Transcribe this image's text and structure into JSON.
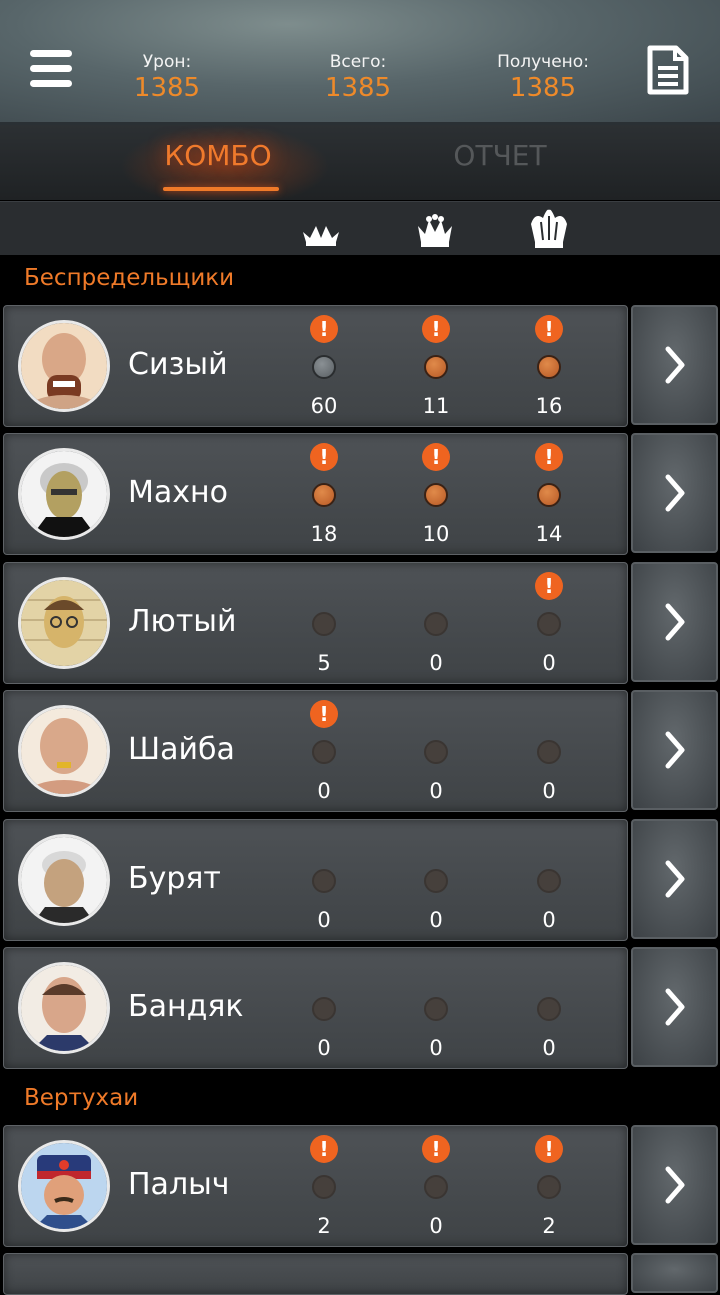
{
  "header": {
    "stats": [
      {
        "label": "Урон:",
        "value": "1385"
      },
      {
        "label": "Всего:",
        "value": "1385"
      },
      {
        "label": "Получено:",
        "value": "1385"
      }
    ]
  },
  "tabs": [
    {
      "label": "КОМБО",
      "active": true
    },
    {
      "label": "ОТЧЕТ",
      "active": false
    }
  ],
  "sections": [
    {
      "title": "Беспредельщики"
    },
    {
      "title": "Вертухаи"
    }
  ],
  "rows": [
    {
      "name": "Сизый",
      "alerts": [
        true,
        true,
        true
      ],
      "dots": [
        "grey",
        "orange",
        "orange"
      ],
      "counts": [
        "60",
        "11",
        "16"
      ]
    },
    {
      "name": "Махно",
      "alerts": [
        true,
        true,
        true
      ],
      "dots": [
        "orange",
        "orange",
        "orange"
      ],
      "counts": [
        "18",
        "10",
        "14"
      ]
    },
    {
      "name": "Лютый",
      "alerts": [
        false,
        false,
        true
      ],
      "dots": [
        "dim",
        "dim",
        "dim"
      ],
      "counts": [
        "5",
        "0",
        "0"
      ]
    },
    {
      "name": "Шайба",
      "alerts": [
        true,
        false,
        false
      ],
      "dots": [
        "dim",
        "dim",
        "dim"
      ],
      "counts": [
        "0",
        "0",
        "0"
      ]
    },
    {
      "name": "Бурят",
      "alerts": [
        false,
        false,
        false
      ],
      "dots": [
        "dim",
        "dim",
        "dim"
      ],
      "counts": [
        "0",
        "0",
        "0"
      ]
    },
    {
      "name": "Бандяк",
      "alerts": [
        false,
        false,
        false
      ],
      "dots": [
        "dim",
        "dim",
        "dim"
      ],
      "counts": [
        "0",
        "0",
        "0"
      ]
    },
    {
      "name": "Палыч",
      "alerts": [
        true,
        true,
        true
      ],
      "dots": [
        "dim",
        "dim",
        "dim"
      ],
      "counts": [
        "2",
        "0",
        "2"
      ]
    }
  ],
  "alert_glyph": "!",
  "colors": {
    "accent": "#ef7a29",
    "alert": "#ef6420",
    "card": "#45494c"
  }
}
